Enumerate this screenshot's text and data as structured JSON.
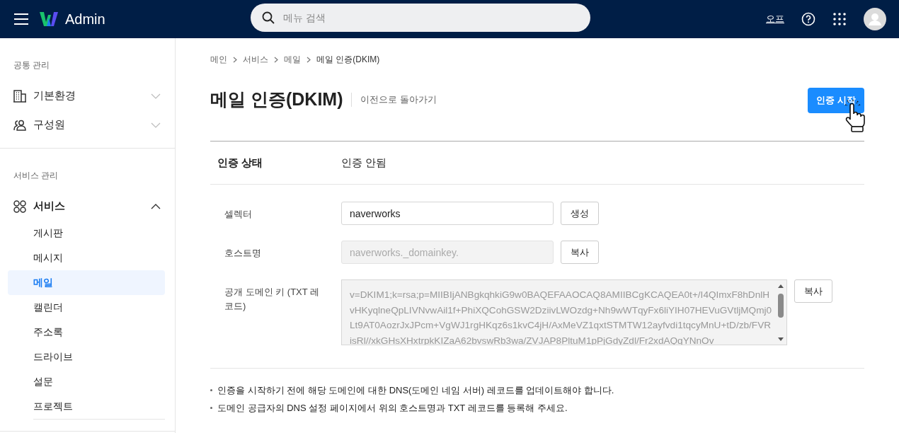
{
  "header": {
    "logo_text": "Admin",
    "search": {
      "placeholder": "메뉴 검색"
    },
    "link": "오프"
  },
  "sidebar": {
    "sections": [
      {
        "title": "공통 관리",
        "items": [
          {
            "label": "기본환경",
            "expanded": false
          },
          {
            "label": "구성원",
            "expanded": false
          }
        ]
      },
      {
        "title": "서비스 관리",
        "items": [
          {
            "label": "서비스",
            "expanded": true,
            "children": [
              {
                "label": "게시판",
                "selected": false
              },
              {
                "label": "메시지",
                "selected": false
              },
              {
                "label": "메일",
                "selected": true
              },
              {
                "label": "캘린더",
                "selected": false
              },
              {
                "label": "주소록",
                "selected": false
              },
              {
                "label": "드라이브",
                "selected": false
              },
              {
                "label": "설문",
                "selected": false
              },
              {
                "label": "프로젝트",
                "selected": false
              }
            ]
          }
        ]
      }
    ]
  },
  "main": {
    "breadcrumb": [
      "메인",
      "서비스",
      "메일",
      "메일 인증(DKIM)"
    ],
    "title": "메일 인증(DKIM)",
    "back_link": "이전으로 돌아가기",
    "primary_button": "인증 시작",
    "status": {
      "label": "인증 상태",
      "value": "인증 안됨"
    },
    "fields": [
      {
        "label": "셀렉터",
        "kind": "input",
        "value": "naverworks",
        "disabled": false,
        "button": "생성"
      },
      {
        "label": "호스트명",
        "kind": "input",
        "value": "naverworks._domainkey.",
        "disabled": true,
        "button": "복사"
      },
      {
        "label": "공개 도메인 키 (TXT 레코드)",
        "kind": "textarea",
        "value": "v=DKIM1;k=rsa;p=MIIBIjANBgkqhkiG9w0BAQEFAAOCAQ8AMIIBCgKCAQEA0t+/I4QImxF8hDnlHvHKyqlneQpLIVNvwAil1f+PhiXQCohGSW2DziivLWOzdg+Nh9wWTqyFx6liYIH07HEVuGVtljMQmj0Lt9AT0AozrJxJPcm+VgWJ1rgHKqz6s1kvC4jH/AxMeVZ1qxtSTMTW12ayfvdi1tqcyMnU+tD/zb/FVRisRl//xkGHsXHxtrpkKIZaA62bvswRb3wa/ZVJAP8PltuM1pPjGdyZdl/Fr2xdAQqYNnOv",
        "disabled": true,
        "button": "복사"
      }
    ],
    "notes": [
      "인증을 시작하기 전에 해당 도메인에 대한 DNS(도메인 네임 서버) 레코드를 업데이트해야 합니다.",
      "도메인 공급자의 DNS 설정 페이지에서 위의 호스트명과 TXT 레코드를 등록해 주세요."
    ]
  }
}
